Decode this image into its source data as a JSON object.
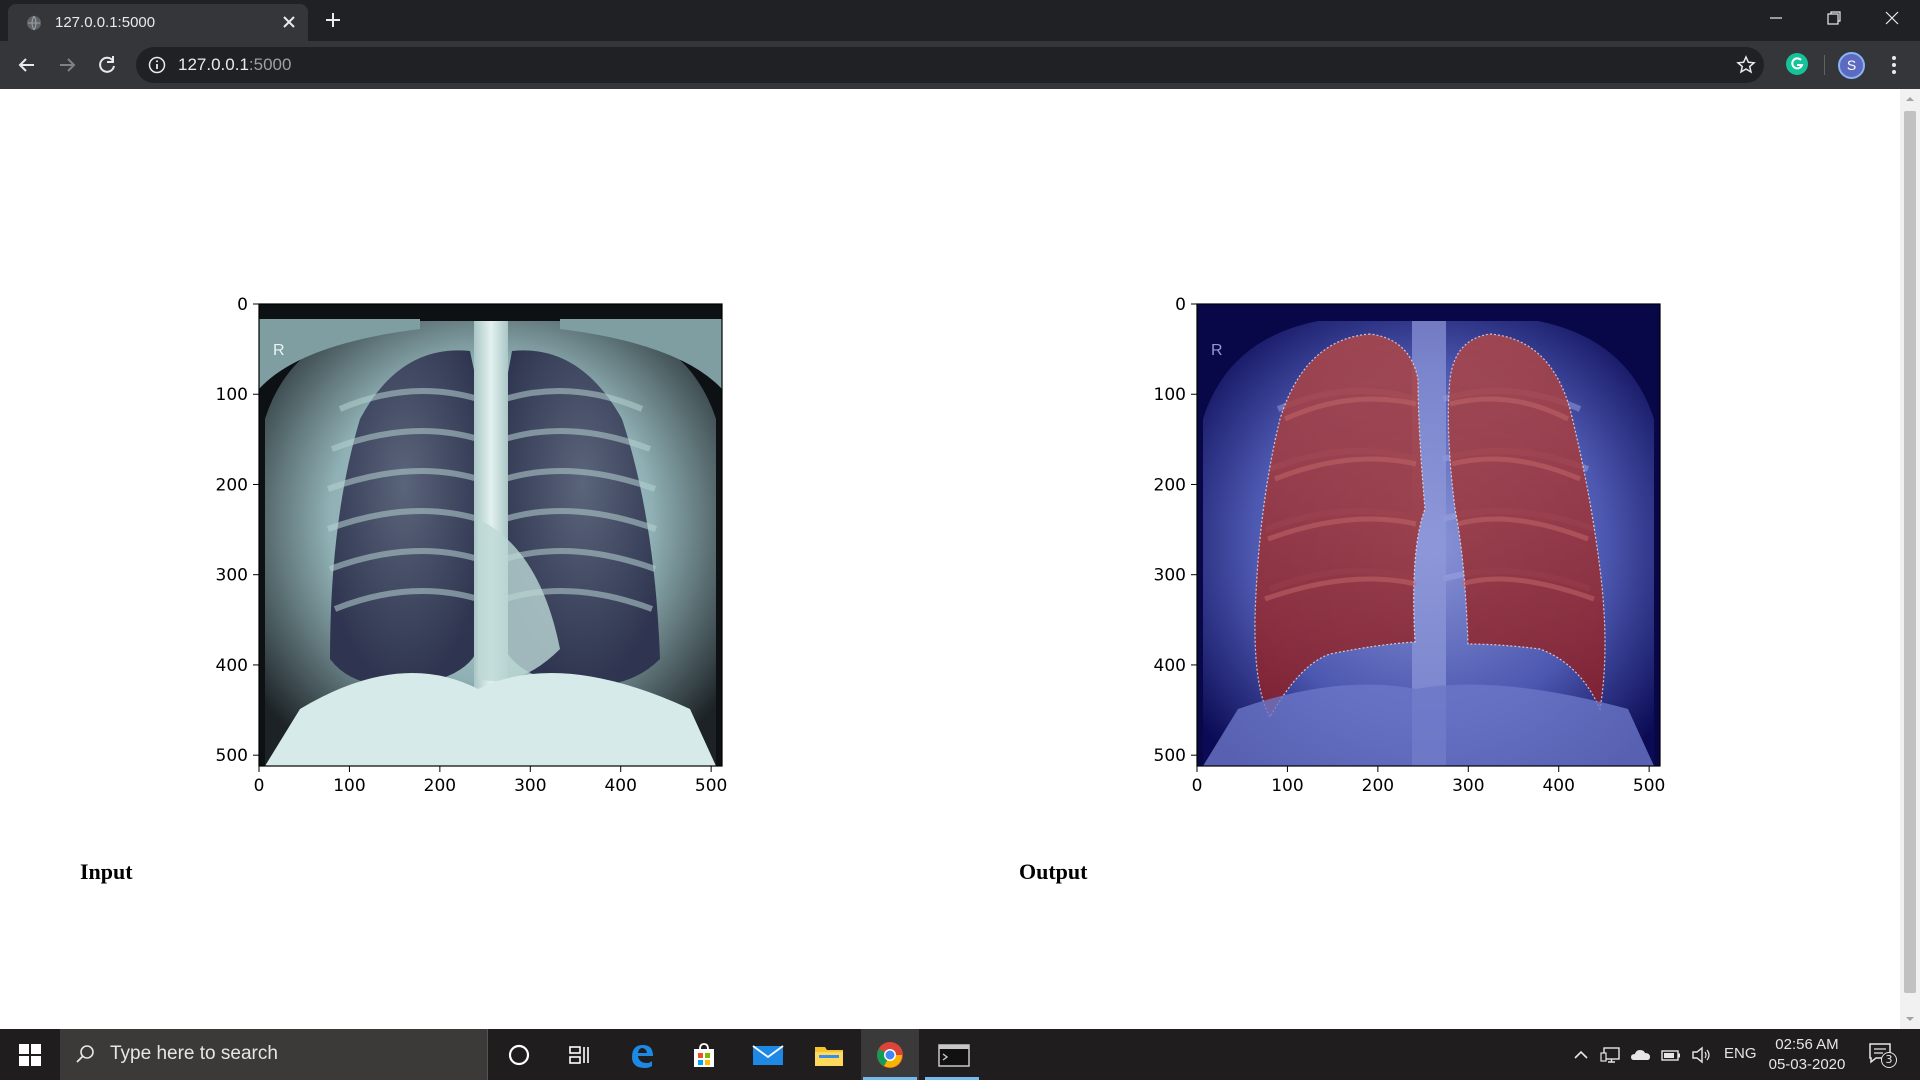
{
  "browser": {
    "tab_title": "127.0.0.1:5000",
    "url_host": "127.0.0.1",
    "url_port": ":5000",
    "profile_initial": "S"
  },
  "page": {
    "input_label": "Input",
    "output_label": "Output"
  },
  "chart_data": [
    {
      "type": "image",
      "title": "",
      "content": "chest X-ray (grayscale, bone colormap)",
      "xticks": [
        0,
        100,
        200,
        300,
        400,
        500
      ],
      "yticks": [
        0,
        100,
        200,
        300,
        400,
        500
      ],
      "xlim": [
        0,
        512
      ],
      "ylim": [
        512,
        0
      ],
      "marker_text": "R"
    },
    {
      "type": "image",
      "title": "",
      "content": "chest X-ray with lung segmentation overlay (blue background, red lung masks)",
      "xticks": [
        0,
        100,
        200,
        300,
        400,
        500
      ],
      "yticks": [
        0,
        100,
        200,
        300,
        400,
        500
      ],
      "xlim": [
        0,
        512
      ],
      "ylim": [
        512,
        0
      ],
      "marker_text": "R"
    }
  ],
  "taskbar": {
    "search_placeholder": "Type here to search",
    "language": "ENG",
    "time": "02:56 AM",
    "date": "05-03-2020",
    "notification_count": "3"
  },
  "colors": {
    "chrome_dark": "#202124",
    "chrome_toolbar": "#35363a",
    "overlay_blue": "#1a1a8c",
    "mask_red": "#a02020",
    "taskbar": "#1f1d1d"
  }
}
